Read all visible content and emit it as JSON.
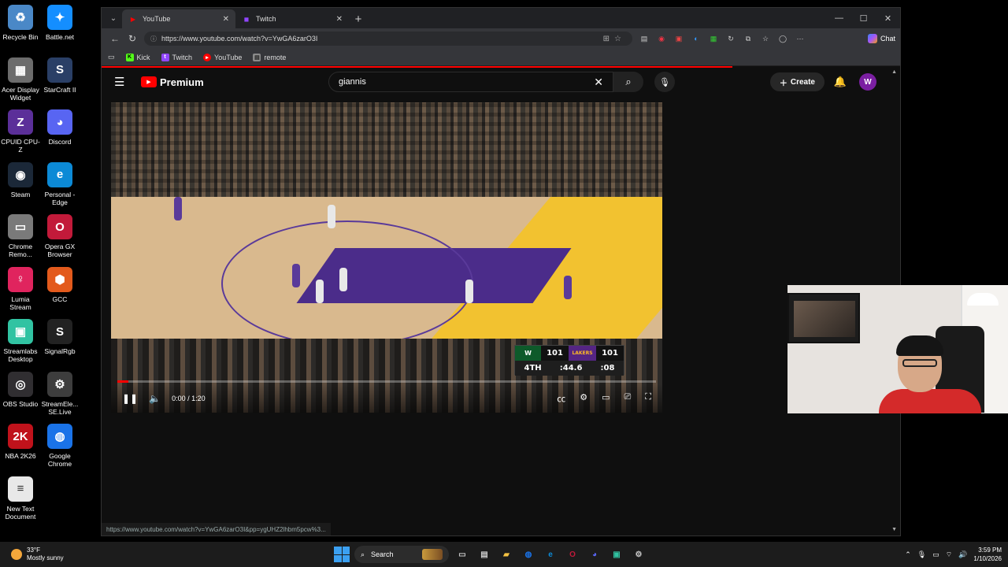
{
  "desktop": {
    "icons": [
      {
        "label": "Recycle Bin",
        "glyph": "♻",
        "color": "#4a88c7"
      },
      {
        "label": "Battle.net",
        "glyph": "✦",
        "color": "#148eff"
      },
      {
        "label": "Acer Display Widget",
        "glyph": "▦",
        "color": "#6c6c6c"
      },
      {
        "label": "StarCraft II",
        "glyph": "S",
        "color": "#2a3f66"
      },
      {
        "label": "CPUID CPU-Z",
        "glyph": "Z",
        "color": "#5b2f99"
      },
      {
        "label": "Discord",
        "glyph": "◕",
        "color": "#5865f2"
      },
      {
        "label": "Steam",
        "glyph": "◉",
        "color": "#1b2838"
      },
      {
        "label": "Personal - Edge",
        "glyph": "e",
        "color": "#0c8ad6"
      },
      {
        "label": "Chrome Remo...",
        "glyph": "▭",
        "color": "#7a7a7a"
      },
      {
        "label": "Opera GX Browser",
        "glyph": "O",
        "color": "#c21a3a"
      },
      {
        "label": "Lumia Stream",
        "glyph": "♀",
        "color": "#e0245e"
      },
      {
        "label": "GCC",
        "glyph": "⬢",
        "color": "#e35a1c"
      },
      {
        "label": "Streamlabs Desktop",
        "glyph": "▣",
        "color": "#31c3a2"
      },
      {
        "label": "SignalRgb",
        "glyph": "S",
        "color": "#222"
      },
      {
        "label": "OBS Studio",
        "glyph": "◎",
        "color": "#302e31"
      },
      {
        "label": "StreamEle... SE.Live",
        "glyph": "⚙",
        "color": "#3d3d3d"
      },
      {
        "label": "NBA 2K26",
        "glyph": "2K",
        "color": "#c0121b"
      },
      {
        "label": "Google Chrome",
        "glyph": "◍",
        "color": "#1a73e8"
      },
      {
        "label": "New Text Document",
        "glyph": "≡",
        "color": "#e8e8e8"
      }
    ]
  },
  "browser": {
    "tabs": [
      {
        "title": "YouTube",
        "icon": "youtube-icon",
        "active": true
      },
      {
        "title": "Twitch",
        "icon": "twitch-icon",
        "active": false
      }
    ],
    "url": "https://www.youtube.com/watch?v=YwGA6zarO3I",
    "chat_label": "Chat",
    "bookmarks": [
      {
        "label": "Kick",
        "icon": "kick-icon",
        "color": "#53fc18"
      },
      {
        "label": "Twitch",
        "icon": "twitch-icon",
        "color": "#9146ff"
      },
      {
        "label": "YouTube",
        "icon": "youtube-icon",
        "color": "#ff0000"
      },
      {
        "label": "remote",
        "icon": "remote-icon",
        "color": "#8a8a8a"
      }
    ],
    "status_url": "https://www.youtube.com/watch?v=YwGA6zarO3I&pp=ygUHZ2lhbm5pcw%3..."
  },
  "youtube": {
    "logo_text": "Premium",
    "search_value": "giannis",
    "create_label": "Create",
    "avatar_letter": "W",
    "player": {
      "time": "0:00 / 1:20",
      "progress": 0.02,
      "score": {
        "home_score": "101",
        "away_score": "101",
        "quarter": "4TH",
        "clock": ":44.6",
        "shot_clock": ":08",
        "home_team": "W",
        "away_team": "LAKERS"
      }
    }
  },
  "taskbar": {
    "temp": "33°F",
    "weather": "Mostly sunny",
    "search_label": "Search",
    "time": "3:59 PM",
    "date": "1/10/2026"
  }
}
